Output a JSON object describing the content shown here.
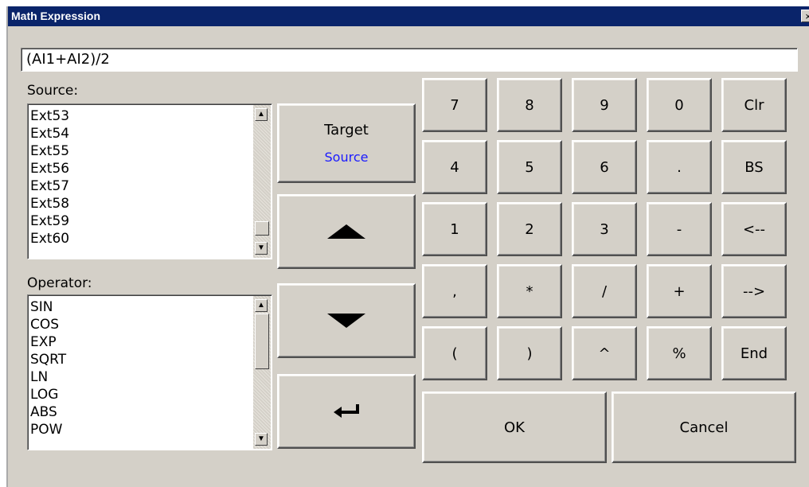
{
  "window": {
    "title": "Math Expression",
    "close_glyph": "×"
  },
  "expression": {
    "value": "(AI1+AI2)/2"
  },
  "source": {
    "label": "Source:",
    "items": [
      "Ext53",
      "Ext54",
      "Ext55",
      "Ext56",
      "Ext57",
      "Ext58",
      "Ext59",
      "Ext60"
    ]
  },
  "operator": {
    "label": "Operator:",
    "items": [
      "SIN",
      "COS",
      "EXP",
      "SQRT",
      "LN",
      "LOG",
      "ABS",
      "POW"
    ]
  },
  "target_button": {
    "label": "Target",
    "sublabel": "Source"
  },
  "icons": {
    "up": "up-arrow-icon",
    "down": "down-arrow-icon",
    "enter": "enter-icon"
  },
  "keypad": {
    "rows": [
      [
        "7",
        "8",
        "9",
        "0",
        "Clr"
      ],
      [
        "4",
        "5",
        "6",
        ".",
        "BS"
      ],
      [
        "1",
        "2",
        "3",
        "-",
        "<--"
      ],
      [
        ",",
        "*",
        "/",
        "+",
        "-->"
      ],
      [
        "(",
        ")",
        "^",
        "%",
        "End"
      ]
    ]
  },
  "buttons": {
    "ok": "OK",
    "cancel": "Cancel"
  },
  "colors": {
    "title_bg": "#0a246a",
    "face": "#d4d0c8",
    "source_accent": "#1a1aff"
  }
}
